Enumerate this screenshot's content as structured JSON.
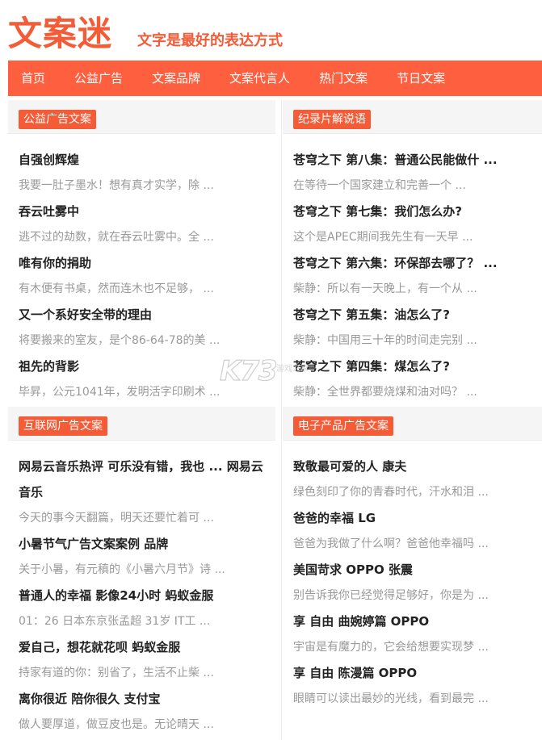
{
  "header": {
    "logo": "文案迷",
    "slogan": "文字是最好的表达方式"
  },
  "nav": {
    "items": [
      "首页",
      "公益广告",
      "文案品牌",
      "文案代言人",
      "热门文案",
      "节日文案"
    ]
  },
  "sections": [
    {
      "tag": "公益广告文案",
      "items": [
        {
          "title": "自强创辉煌",
          "desc": "我要一肚子墨水！想有真才实学，除 ..."
        },
        {
          "title": "吞云吐雾中",
          "desc": "逃不过的劫数，就在吞云吐雾中。全 ..."
        },
        {
          "title": "唯有你的捐助",
          "desc": "有木便有书桌，然而连木也不足够， ..."
        },
        {
          "title": "又一个系好安全带的理由",
          "desc": "将要搬来的室友，是个86-64-78的美 ..."
        },
        {
          "title": "祖先的背影",
          "desc": "毕昇，公元1041年，发明活字印刷术 ..."
        }
      ]
    },
    {
      "tag": "纪录片解说语",
      "items": [
        {
          "title": "苍穹之下 第八集：普通公民能做什 ...",
          "desc": "在等待一个国家建立和完善一个 ..."
        },
        {
          "title": "苍穹之下 第七集：我们怎么办?",
          "desc": "这个是APEC期间我先生有一天早 ..."
        },
        {
          "title": "苍穹之下 第六集：环保部去哪了？ ...",
          "desc": "柴静：所以有一天晚上，有一个从 ..."
        },
        {
          "title": "苍穹之下 第五集：油怎么了?",
          "desc": "柴静：中国用三十年的时间走完别 ..."
        },
        {
          "title": "苍穹之下 第四集：煤怎么了?",
          "desc": "柴静：全世界都要烧煤和油对吗？ ..."
        }
      ]
    },
    {
      "tag": "互联网广告文案",
      "items": [
        {
          "title": "网易云音乐热评 可乐没有错，我也 ... 网易云音乐",
          "desc": "今天的事今天翻篇，明天还要忙着可 ..."
        },
        {
          "title": "小暑节气广告文案案例 品牌",
          "desc": "关于小暑，有元稹的《小暑六月节》诗 ..."
        },
        {
          "title": "普通人的幸福 影像24小时 蚂蚁金服",
          "desc": "01：26 日本东京张孟超 31岁 IT工 ..."
        },
        {
          "title": "爱自己，想花就花呗 蚂蚁金服",
          "desc": "持家有道的你：别省了，生活不止柴 ..."
        },
        {
          "title": "离你很近 陪你很久 支付宝",
          "desc": "做人要厚道，做豆皮也是。无论晴天 ..."
        }
      ]
    },
    {
      "tag": "电子产品广告文案",
      "items": [
        {
          "title": "致敬最可爱的人 康夫",
          "desc": "绿色刻印了你的青春时代，汗水和泪 ..."
        },
        {
          "title": "爸爸的幸福 LG",
          "desc": "爸爸为我做了什么啊？爸爸他幸福吗 ..."
        },
        {
          "title": "美国苛求 OPPO 张震",
          "desc": "别告诉我你已经觉得足够好，你是为 ..."
        },
        {
          "title": "享 自由 曲婉婷篇 OPPO",
          "desc": "宇宙是有魔力的，它会给想要实现梦 ..."
        },
        {
          "title": "享 自由 陈漫篇 OPPO",
          "desc": "眼睛可以读出最妙的光线，看到最完 ..."
        }
      ]
    }
  ],
  "watermark": {
    "main": "K73",
    "sub": "游戏之家"
  }
}
